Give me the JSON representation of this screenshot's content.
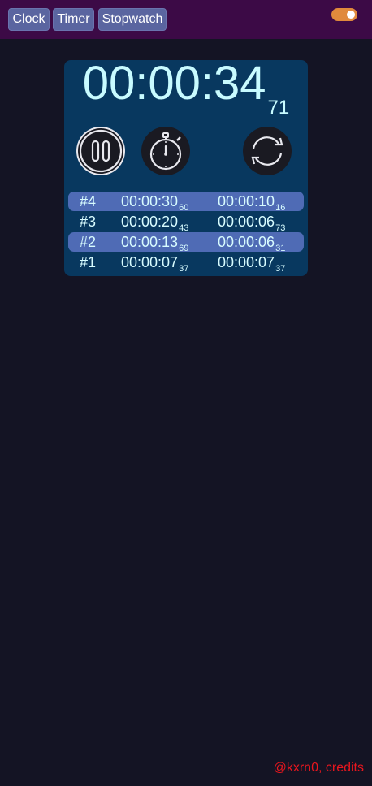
{
  "nav": {
    "clock_label": "Clock",
    "timer_label": "Timer",
    "stopwatch_label": "Stopwatch"
  },
  "theme_toggle": {
    "state": "on",
    "color": "#e08a3c"
  },
  "display": {
    "main": "00:00:34",
    "centiseconds": "71"
  },
  "controls": {
    "pause_icon": "pause-icon",
    "lap_icon": "stopwatch-icon",
    "reset_icon": "reset-icon"
  },
  "laps": [
    {
      "number": "#4",
      "total_main": "00:00:30",
      "total_centi": "60",
      "split_main": "00:00:10",
      "split_centi": "16",
      "highlight": true
    },
    {
      "number": "#3",
      "total_main": "00:00:20",
      "total_centi": "43",
      "split_main": "00:00:06",
      "split_centi": "73",
      "highlight": false
    },
    {
      "number": "#2",
      "total_main": "00:00:13",
      "total_centi": "69",
      "split_main": "00:00:06",
      "split_centi": "31",
      "highlight": true
    },
    {
      "number": "#1",
      "total_main": "00:00:07",
      "total_centi": "37",
      "split_main": "00:00:07",
      "split_centi": "37",
      "highlight": false
    }
  ],
  "footer": {
    "credits": "@kxrn0, credits"
  },
  "colors": {
    "background": "#141424",
    "topbar": "#3c0a46",
    "card": "#08385f",
    "lap_highlight": "#4f6bb5",
    "text": "#c8fbff",
    "credits": "#e8161e"
  }
}
